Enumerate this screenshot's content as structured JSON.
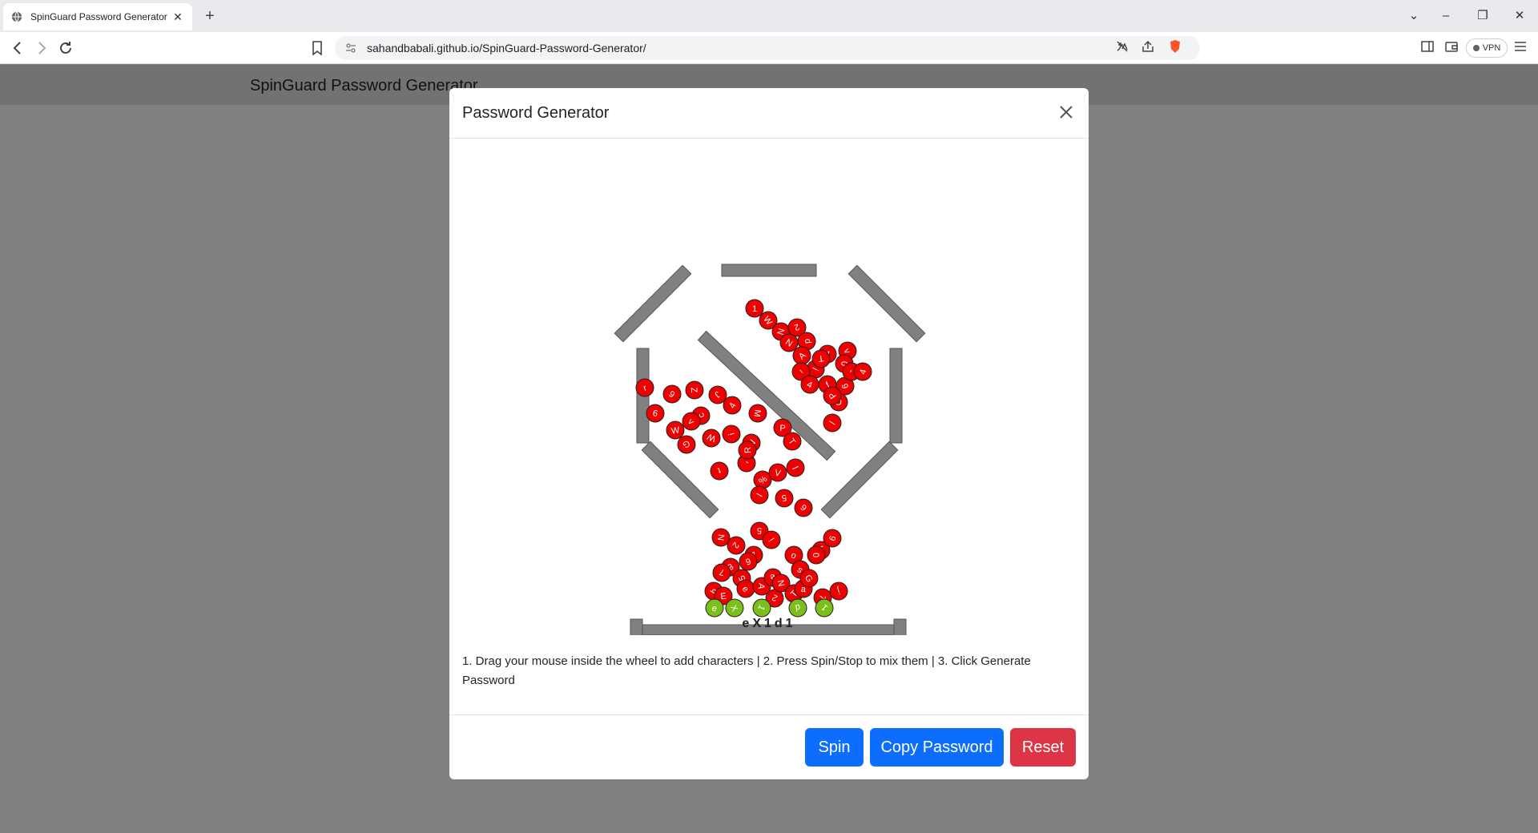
{
  "browser": {
    "tab_title": "SpinGuard Password Generator",
    "tab_close": "✕",
    "new_tab": "+",
    "url": "sahandbabali.github.io/SpinGuard-Password-Generator/",
    "vpn_label": "VPN",
    "window_controls": {
      "tablist": "⌄",
      "minimize": "–",
      "restore": "❐",
      "close": "✕"
    }
  },
  "page": {
    "brand": "SpinGuard Password Generator"
  },
  "modal": {
    "title": "Password Generator",
    "password": "eX1d1",
    "instructions": "1. Drag your mouse inside the wheel to add characters | 2. Press Spin/Stop to mix them | 3. Click Generate Password",
    "buttons": {
      "spin": "Spin",
      "copy": "Copy Password",
      "reset": "Reset"
    },
    "colors": {
      "primary": "#0d6efd",
      "danger": "#dc3545",
      "ball_red": "#ee0000",
      "ball_green": "#7bbf1a",
      "wall": "#808080"
    }
  },
  "wheel": {
    "red_balls": [
      {
        "c": "1"
      },
      {
        "c": "W"
      },
      {
        "c": "N"
      },
      {
        "c": "2"
      },
      {
        "c": "N"
      },
      {
        "c": "p"
      },
      {
        "c": "A"
      },
      {
        "c": "4"
      },
      {
        "c": "v"
      },
      {
        "c": "i"
      },
      {
        "c": "T"
      },
      {
        "c": "~"
      },
      {
        "c": "0"
      },
      {
        "c": "f"
      },
      {
        "c": "4"
      },
      {
        "c": "9"
      },
      {
        "c": "-"
      },
      {
        "c": "C"
      },
      {
        "c": "P"
      },
      {
        "c": "4"
      },
      {
        "c": "r"
      },
      {
        "c": "9"
      },
      {
        "c": "Z"
      },
      {
        "c": "J"
      },
      {
        "c": "9"
      },
      {
        "c": "c"
      },
      {
        "c": "4"
      },
      {
        "c": "W"
      },
      {
        "c": "v"
      },
      {
        "c": "M"
      },
      {
        "c": "G"
      },
      {
        "c": "W"
      },
      {
        "c": "i"
      },
      {
        "c": "N"
      },
      {
        "c": "P"
      },
      {
        "c": "T"
      },
      {
        "c": "/"
      },
      {
        "c": "t"
      },
      {
        "c": "-"
      },
      {
        "c": "R"
      },
      {
        "c": "%"
      },
      {
        "c": "V"
      },
      {
        "c": "l"
      },
      {
        "c": "l"
      },
      {
        "c": "5"
      },
      {
        "c": "6"
      },
      {
        "c": "N"
      },
      {
        "c": "7"
      },
      {
        "c": "o"
      },
      {
        "c": "W"
      },
      {
        "c": "2"
      },
      {
        "c": "5"
      },
      {
        "c": "i"
      },
      {
        "c": "6"
      },
      {
        "c": "9"
      },
      {
        "c": "s"
      },
      {
        "c": "0"
      },
      {
        "c": "8"
      },
      {
        "c": "7"
      },
      {
        "c": "5"
      },
      {
        "c": "h"
      },
      {
        "c": "E"
      },
      {
        "c": "e"
      },
      {
        "c": "A"
      },
      {
        "c": "e"
      },
      {
        "c": "2"
      },
      {
        "c": "N"
      },
      {
        "c": "T"
      },
      {
        "c": "a"
      },
      {
        "c": "G"
      },
      {
        "c": "7"
      },
      {
        "c": "j"
      }
    ],
    "green_balls": [
      {
        "c": "e"
      },
      {
        "c": "X"
      },
      {
        "c": "1"
      },
      {
        "c": "d"
      },
      {
        "c": "1"
      }
    ]
  }
}
